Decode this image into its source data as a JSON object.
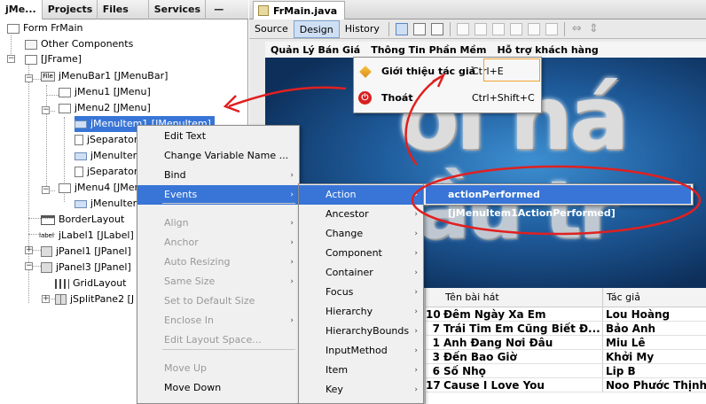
{
  "left_tabs": [
    "jMe...",
    "Projects",
    "Files",
    "Services"
  ],
  "tree": [
    {
      "label": "Form FrMain",
      "icon": "form-icon"
    },
    {
      "label": "Other Components",
      "icon": "folder-icon"
    },
    {
      "label": "[JFrame]",
      "icon": "frame-icon"
    },
    {
      "label": "jMenuBar1 [JMenuBar]",
      "icon": "menubar-icon"
    },
    {
      "label": "jMenu1 [JMenu]",
      "icon": "menu-icon"
    },
    {
      "label": "jMenu2 [JMenu]",
      "icon": "menu-icon"
    },
    {
      "label": "jMenuItem1 [JMenuItem]",
      "icon": "menuitem-icon"
    },
    {
      "label": "jSeparator",
      "icon": "separator-icon"
    },
    {
      "label": "jMenuItem",
      "icon": "menuitem-icon"
    },
    {
      "label": "jSeparator",
      "icon": "separator-icon"
    },
    {
      "label": "jMenu4 [JMenu]",
      "icon": "menu-icon"
    },
    {
      "label": "jMenuItem",
      "icon": "menuitem-icon"
    },
    {
      "label": "BorderLayout",
      "icon": "layout-icon"
    },
    {
      "label": "jLabel1 [JLabel]",
      "icon": "label-icon"
    },
    {
      "label": "jPanel1 [JPanel]",
      "icon": "panel-icon"
    },
    {
      "label": "jPanel3 [JPanel]",
      "icon": "panel-icon"
    },
    {
      "label": "GridLayout",
      "icon": "layout-icon"
    },
    {
      "label": "jSplitPane2 [J",
      "icon": "splitpane-icon"
    }
  ],
  "label_icon_text": "label",
  "file_icon_text": "File",
  "editor_tab": "FrMain.java",
  "toolbar": {
    "source": "Source",
    "design": "Design",
    "history": "History"
  },
  "app_menubar": [
    "Quản Lý Bán Giá",
    "Thông Tin Phần Mềm",
    "Hỗ trợ khách hàng"
  ],
  "popup": {
    "item1": {
      "label": "Giới thiệu tác giả",
      "shortcut": "Ctrl+E"
    },
    "item2": {
      "label": "Thoát",
      "shortcut": "Ctrl+Shift+C"
    }
  },
  "context_menu": {
    "items": [
      {
        "label": "Edit Text",
        "disabled": false,
        "submenu": false
      },
      {
        "label": "Change Variable Name ...",
        "disabled": false,
        "submenu": false
      },
      {
        "label": "Bind",
        "disabled": false,
        "submenu": true
      },
      {
        "label": "Events",
        "disabled": false,
        "submenu": true,
        "highlight": true
      },
      {
        "label": "Align",
        "disabled": true,
        "submenu": true
      },
      {
        "label": "Anchor",
        "disabled": true,
        "submenu": true
      },
      {
        "label": "Auto Resizing",
        "disabled": true,
        "submenu": true
      },
      {
        "label": "Same Size",
        "disabled": true,
        "submenu": true
      },
      {
        "label": "Set to Default Size",
        "disabled": true,
        "submenu": false
      },
      {
        "label": "Enclose In",
        "disabled": true,
        "submenu": true
      },
      {
        "label": "Edit Layout Space...",
        "disabled": true,
        "submenu": false
      },
      {
        "label": "Move Up",
        "disabled": true,
        "submenu": false
      },
      {
        "label": "Move Down",
        "disabled": false,
        "submenu": false
      }
    ]
  },
  "events_menu": [
    "Action",
    "Ancestor",
    "Change",
    "Component",
    "Container",
    "Focus",
    "Hierarchy",
    "HierarchyBounds",
    "InputMethod",
    "Item",
    "Key"
  ],
  "action_menu": [
    "actionPerformed [jMenuItem1ActionPerformed]"
  ],
  "table": {
    "headers": [
      "Tên bài hát",
      "Tác giả"
    ],
    "rows": [
      {
        "n": "10",
        "song": "Đêm Ngày Xa Em",
        "author": "Lou Hoàng"
      },
      {
        "n": "7",
        "song": "Trái Tim Em Cũng Biết Đ...",
        "author": "Bảo Anh"
      },
      {
        "n": "1",
        "song": "Anh Đang Nơi Đâu",
        "author": "Miu Lê"
      },
      {
        "n": "3",
        "song": "Đến Bao Giờ",
        "author": "Khởi My"
      },
      {
        "n": "6",
        "song": "Số Nhọ",
        "author": "Lip B"
      },
      {
        "n": "17",
        "song": "Cause I Love You",
        "author": "Noo Phước Thịnh"
      }
    ]
  },
  "colors": {
    "highlight": "#3875d7",
    "annotation": "#e02020",
    "canvas": "#1f5c9c"
  }
}
